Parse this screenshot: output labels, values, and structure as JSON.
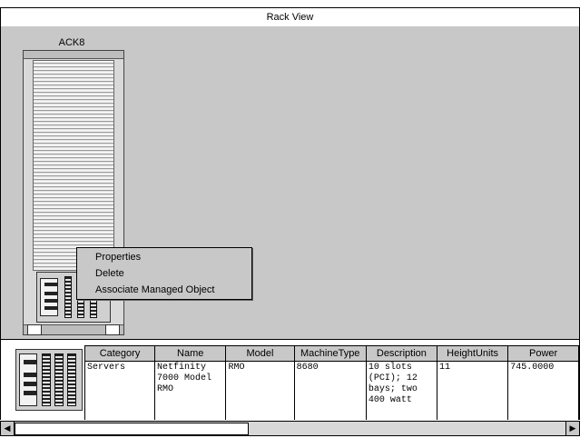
{
  "window": {
    "title": "Rack View"
  },
  "rack": {
    "name": "ACK8"
  },
  "context_menu": {
    "items": [
      {
        "label": "Properties"
      },
      {
        "label": "Delete"
      },
      {
        "label": "Associate Managed Object"
      }
    ]
  },
  "table": {
    "columns": [
      "Category",
      "Name",
      "Model",
      "MachineType",
      "Description",
      "HeightUnits",
      "Power"
    ],
    "rows": [
      {
        "category": "Servers",
        "name": "Netfinity 7000 Model RMO",
        "model": "RMO",
        "machine_type": "8680",
        "description": "10 slots (PCI); 12 bays; two 400 watt",
        "height_units": "11",
        "power": "745.0000"
      }
    ]
  },
  "scrollbar": {
    "left_icon": "arrow-left-icon",
    "right_icon": "arrow-right-icon"
  }
}
